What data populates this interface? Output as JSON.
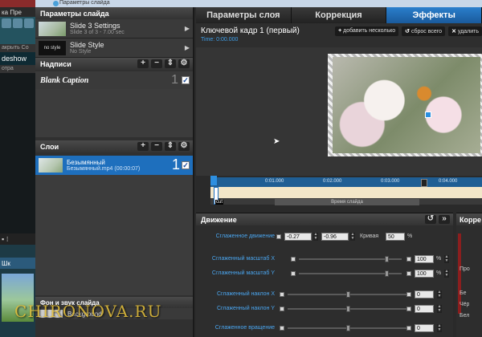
{
  "bg_app": {
    "menu": "ка  Пре",
    "toolbar_labels": "акрыть  Со",
    "slideshow_label": "deshow",
    "strip_label": "отра",
    "controls": "▪ ⁝",
    "tab_label": "Шк"
  },
  "window": {
    "title": "Параметры слайда"
  },
  "left_panel": {
    "slide_params_header": "Параметры слайда",
    "slides": [
      {
        "title": "Slide 3 Settings",
        "subtitle": "Slide 3 of 3 - 7.00 sec",
        "thumb": "image"
      },
      {
        "title": "Slide Style",
        "subtitle": "No Style",
        "thumb_text": "no style"
      }
    ],
    "captions_header": "Надписи",
    "captions": [
      {
        "label": "Blank Caption",
        "number": "1"
      }
    ],
    "layers_header": "Слои",
    "layers": [
      {
        "title": "Безымянный",
        "subtitle": "Безымянный.mp4 (00:00:07)",
        "number": "1"
      }
    ],
    "bg_header": "Фон и звук слайда",
    "bg_item": "Background"
  },
  "tabs": [
    {
      "label": "Параметры слоя",
      "active": false
    },
    {
      "label": "Коррекция",
      "active": false
    },
    {
      "label": "Эффекты",
      "active": true
    }
  ],
  "keyframe": {
    "title": "Ключевой кадр 1 (первый)",
    "time": "Time: 0:00.000",
    "add_btn": "добавить  несколько",
    "reset_btn": "сброс всего",
    "delete_btn": "удалить"
  },
  "timeline": {
    "ticks": [
      "0:01.000",
      "0:02.000",
      "0:03.000",
      "0:04.000"
    ],
    "marker": "1",
    "knob": "2",
    "label": "Время слайда",
    "cut": "cut"
  },
  "motion": {
    "header": "Движение",
    "rows": [
      {
        "label": "Сглаженное движение",
        "v1": "-0.27",
        "v2": "-0.96",
        "curve_label": "Кривая",
        "curve_val": "50",
        "pct": "%"
      },
      {
        "label": "Сглаженный масштаб X",
        "value": "100",
        "pct": "%",
        "level": 0.85
      },
      {
        "label": "Сглаженный масштаб Y",
        "value": "100",
        "pct": "%",
        "level": 0.85
      },
      {
        "label": "Сглаженный наклон X",
        "value": "0",
        "level": 0.5
      },
      {
        "label": "Сглаженный наклон Y",
        "value": "0",
        "level": 0.5
      },
      {
        "label": "Сглаженное вращение",
        "value": "0",
        "level": 0.5
      }
    ]
  },
  "correction": {
    "header": "Корре",
    "labels": [
      "Про",
      "Бе",
      "Чёр",
      "Бел"
    ]
  },
  "watermark": "CHIRONOVA.RU",
  "colors": {
    "accent": "#1e6fbd",
    "active_tab": "#2a7fcc",
    "label_blue": "#4aa6f0",
    "watermark": "#e6c13a"
  }
}
